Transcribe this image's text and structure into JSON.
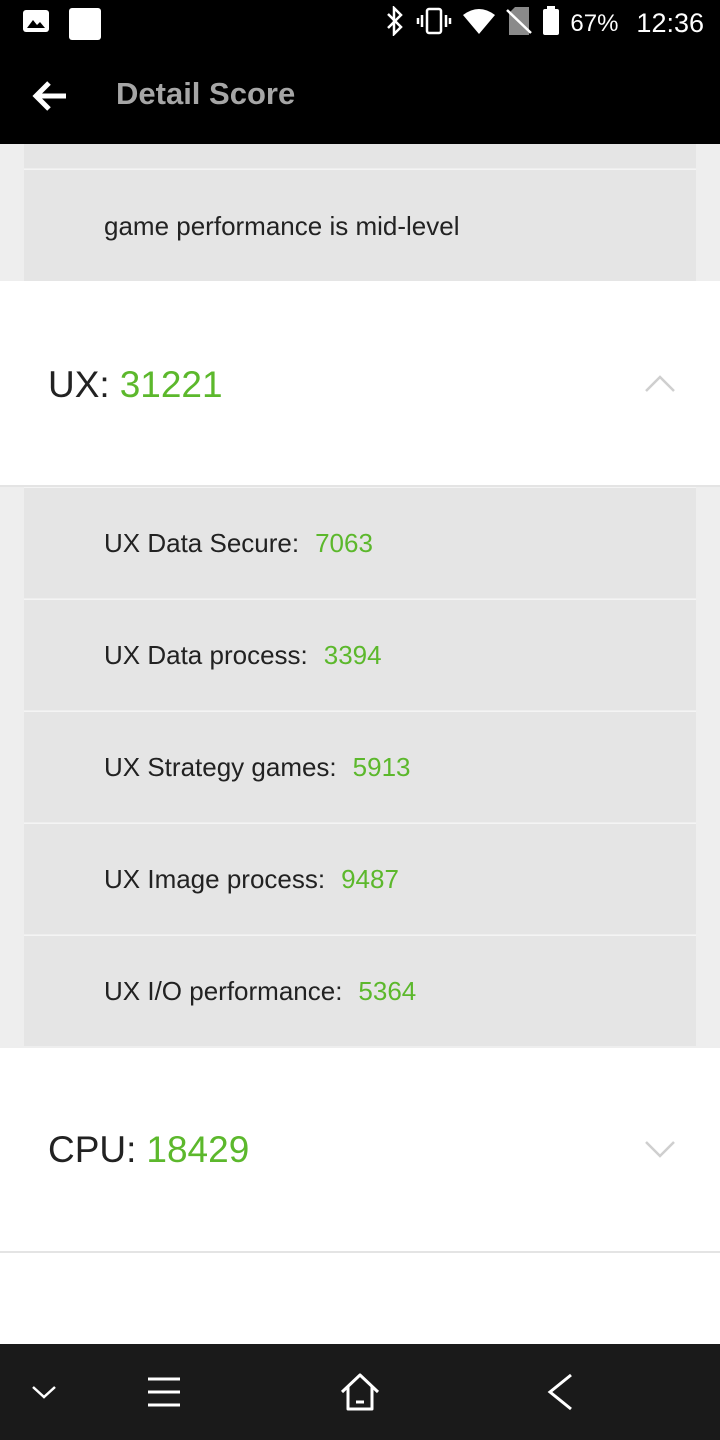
{
  "status_bar": {
    "battery_percent": "67%",
    "time": "12:36"
  },
  "app_bar": {
    "title": "Detail Score"
  },
  "game_section": {
    "summary": "game performance is mid-level"
  },
  "ux_section": {
    "label": "UX:",
    "score": "31221",
    "expanded": true,
    "items": [
      {
        "label": "UX Data Secure:",
        "value": "7063"
      },
      {
        "label": "UX Data process:",
        "value": "3394"
      },
      {
        "label": "UX Strategy games:",
        "value": "5913"
      },
      {
        "label": "UX Image process:",
        "value": "9487"
      },
      {
        "label": "UX I/O performance:",
        "value": "5364"
      }
    ]
  },
  "cpu_section": {
    "label": "CPU:",
    "score": "18429",
    "expanded": false
  },
  "colors": {
    "score_green": "#5cb82c",
    "bar_black": "#000000",
    "nav_bar": "#1a1a1a",
    "card_grey": "#e5e5e5"
  },
  "icons": {
    "status_left": [
      "image-icon",
      "notification-square-icon"
    ],
    "status_right": [
      "bluetooth-icon",
      "vibrate-icon",
      "wifi-icon",
      "no-sim-icon",
      "battery-icon"
    ],
    "nav": [
      "hide-keyboard-icon",
      "menu-icon",
      "home-icon",
      "back-icon"
    ]
  }
}
